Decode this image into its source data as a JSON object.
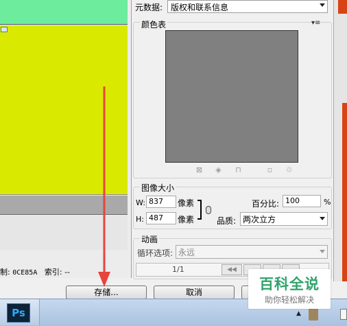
{
  "metadata": {
    "label": "元数据:",
    "value": "版权和联系信息"
  },
  "color_table": {
    "title": "颜色表",
    "swatch_color": "#808080"
  },
  "image_size": {
    "title": "图像大小",
    "w_label": "W:",
    "w_value": "837",
    "w_unit": "像素",
    "h_label": "H:",
    "h_value": "487",
    "h_unit": "像素",
    "percent_label": "百分比:",
    "percent_value": "100",
    "percent_unit": "%",
    "quality_label": "品质:",
    "quality_value": "两次立方"
  },
  "animation": {
    "title": "动画",
    "loop_label": "循环选项:",
    "loop_value": "永远",
    "frame_counter": "1/1"
  },
  "status": {
    "code_label": "制:",
    "code_value": "0CE85A",
    "index_label": "索引:",
    "index_value": "--"
  },
  "buttons": {
    "save": "存储...",
    "cancel": "取消"
  },
  "taskbar": {
    "ps_label": "Ps"
  },
  "watermark": {
    "main": "百科全说",
    "sub": "助你轻松解决"
  },
  "colors": {
    "green_band": "#6cec9c",
    "yellow_band": "#d9ea00",
    "arrow": "#e8433c",
    "brand": "#2fa36b"
  }
}
